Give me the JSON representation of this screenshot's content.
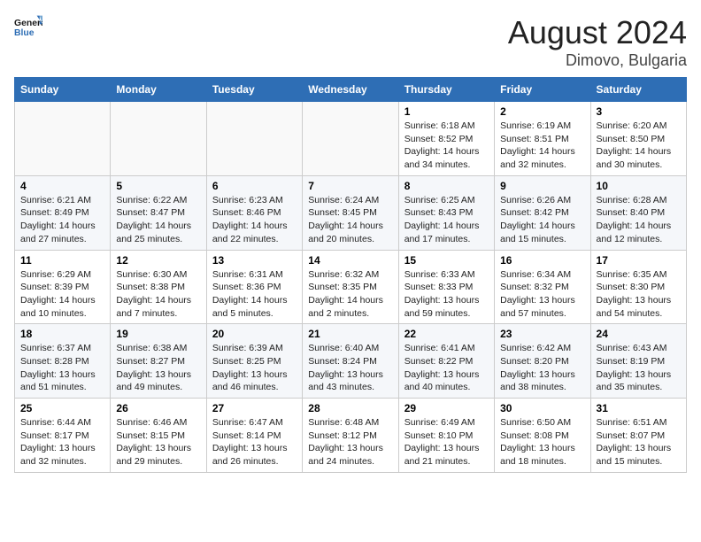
{
  "header": {
    "logo_general": "General",
    "logo_blue": "Blue",
    "title": "August 2024",
    "subtitle": "Dimovo, Bulgaria"
  },
  "columns": [
    "Sunday",
    "Monday",
    "Tuesday",
    "Wednesday",
    "Thursday",
    "Friday",
    "Saturday"
  ],
  "weeks": [
    [
      {
        "day": "",
        "info": ""
      },
      {
        "day": "",
        "info": ""
      },
      {
        "day": "",
        "info": ""
      },
      {
        "day": "",
        "info": ""
      },
      {
        "day": "1",
        "info": "Sunrise: 6:18 AM\nSunset: 8:52 PM\nDaylight: 14 hours\nand 34 minutes."
      },
      {
        "day": "2",
        "info": "Sunrise: 6:19 AM\nSunset: 8:51 PM\nDaylight: 14 hours\nand 32 minutes."
      },
      {
        "day": "3",
        "info": "Sunrise: 6:20 AM\nSunset: 8:50 PM\nDaylight: 14 hours\nand 30 minutes."
      }
    ],
    [
      {
        "day": "4",
        "info": "Sunrise: 6:21 AM\nSunset: 8:49 PM\nDaylight: 14 hours\nand 27 minutes."
      },
      {
        "day": "5",
        "info": "Sunrise: 6:22 AM\nSunset: 8:47 PM\nDaylight: 14 hours\nand 25 minutes."
      },
      {
        "day": "6",
        "info": "Sunrise: 6:23 AM\nSunset: 8:46 PM\nDaylight: 14 hours\nand 22 minutes."
      },
      {
        "day": "7",
        "info": "Sunrise: 6:24 AM\nSunset: 8:45 PM\nDaylight: 14 hours\nand 20 minutes."
      },
      {
        "day": "8",
        "info": "Sunrise: 6:25 AM\nSunset: 8:43 PM\nDaylight: 14 hours\nand 17 minutes."
      },
      {
        "day": "9",
        "info": "Sunrise: 6:26 AM\nSunset: 8:42 PM\nDaylight: 14 hours\nand 15 minutes."
      },
      {
        "day": "10",
        "info": "Sunrise: 6:28 AM\nSunset: 8:40 PM\nDaylight: 14 hours\nand 12 minutes."
      }
    ],
    [
      {
        "day": "11",
        "info": "Sunrise: 6:29 AM\nSunset: 8:39 PM\nDaylight: 14 hours\nand 10 minutes."
      },
      {
        "day": "12",
        "info": "Sunrise: 6:30 AM\nSunset: 8:38 PM\nDaylight: 14 hours\nand 7 minutes."
      },
      {
        "day": "13",
        "info": "Sunrise: 6:31 AM\nSunset: 8:36 PM\nDaylight: 14 hours\nand 5 minutes."
      },
      {
        "day": "14",
        "info": "Sunrise: 6:32 AM\nSunset: 8:35 PM\nDaylight: 14 hours\nand 2 minutes."
      },
      {
        "day": "15",
        "info": "Sunrise: 6:33 AM\nSunset: 8:33 PM\nDaylight: 13 hours\nand 59 minutes."
      },
      {
        "day": "16",
        "info": "Sunrise: 6:34 AM\nSunset: 8:32 PM\nDaylight: 13 hours\nand 57 minutes."
      },
      {
        "day": "17",
        "info": "Sunrise: 6:35 AM\nSunset: 8:30 PM\nDaylight: 13 hours\nand 54 minutes."
      }
    ],
    [
      {
        "day": "18",
        "info": "Sunrise: 6:37 AM\nSunset: 8:28 PM\nDaylight: 13 hours\nand 51 minutes."
      },
      {
        "day": "19",
        "info": "Sunrise: 6:38 AM\nSunset: 8:27 PM\nDaylight: 13 hours\nand 49 minutes."
      },
      {
        "day": "20",
        "info": "Sunrise: 6:39 AM\nSunset: 8:25 PM\nDaylight: 13 hours\nand 46 minutes."
      },
      {
        "day": "21",
        "info": "Sunrise: 6:40 AM\nSunset: 8:24 PM\nDaylight: 13 hours\nand 43 minutes."
      },
      {
        "day": "22",
        "info": "Sunrise: 6:41 AM\nSunset: 8:22 PM\nDaylight: 13 hours\nand 40 minutes."
      },
      {
        "day": "23",
        "info": "Sunrise: 6:42 AM\nSunset: 8:20 PM\nDaylight: 13 hours\nand 38 minutes."
      },
      {
        "day": "24",
        "info": "Sunrise: 6:43 AM\nSunset: 8:19 PM\nDaylight: 13 hours\nand 35 minutes."
      }
    ],
    [
      {
        "day": "25",
        "info": "Sunrise: 6:44 AM\nSunset: 8:17 PM\nDaylight: 13 hours\nand 32 minutes."
      },
      {
        "day": "26",
        "info": "Sunrise: 6:46 AM\nSunset: 8:15 PM\nDaylight: 13 hours\nand 29 minutes."
      },
      {
        "day": "27",
        "info": "Sunrise: 6:47 AM\nSunset: 8:14 PM\nDaylight: 13 hours\nand 26 minutes."
      },
      {
        "day": "28",
        "info": "Sunrise: 6:48 AM\nSunset: 8:12 PM\nDaylight: 13 hours\nand 24 minutes."
      },
      {
        "day": "29",
        "info": "Sunrise: 6:49 AM\nSunset: 8:10 PM\nDaylight: 13 hours\nand 21 minutes."
      },
      {
        "day": "30",
        "info": "Sunrise: 6:50 AM\nSunset: 8:08 PM\nDaylight: 13 hours\nand 18 minutes."
      },
      {
        "day": "31",
        "info": "Sunrise: 6:51 AM\nSunset: 8:07 PM\nDaylight: 13 hours\nand 15 minutes."
      }
    ]
  ]
}
